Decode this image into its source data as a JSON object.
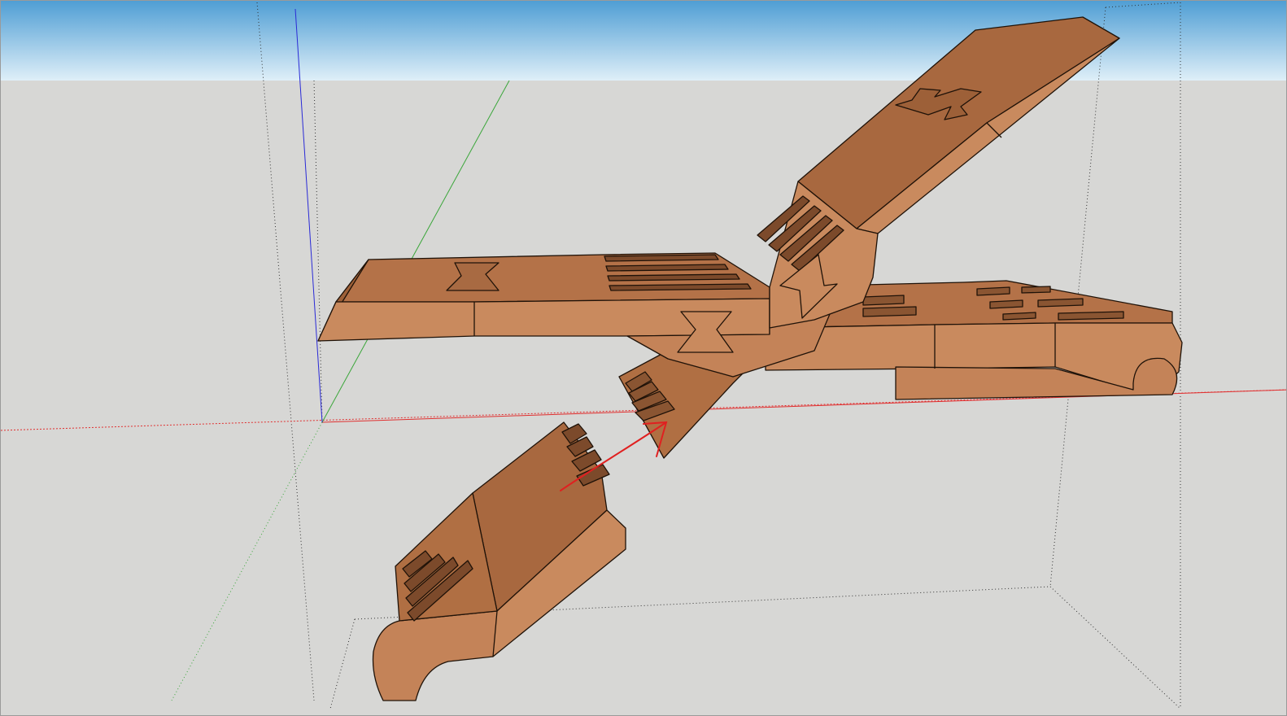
{
  "app": {
    "kind": "3d-modeling-viewport"
  },
  "scene": {
    "sky_top_color": "#4f9ed4",
    "sky_bottom_color": "#dfeff8",
    "ground_color": "#d7d7d5",
    "wood_light": "#c98a5e",
    "wood_mid": "#b06f43",
    "wood_dark": "#7c4a2b",
    "edge_color": "#1f1208",
    "axis_red": "#e03030",
    "axis_green": "#3aa63a",
    "axis_blue": "#2a2ad6",
    "annotation_arrow_color": "#e02020"
  },
  "model": {
    "components": [
      {
        "id": "left-beam",
        "label": ""
      },
      {
        "id": "right-beam",
        "label": ""
      },
      {
        "id": "rising-beam",
        "label": ""
      },
      {
        "id": "loose-piece",
        "label": ""
      }
    ]
  },
  "annotation": {
    "type": "arrow",
    "meaning": "insert"
  }
}
